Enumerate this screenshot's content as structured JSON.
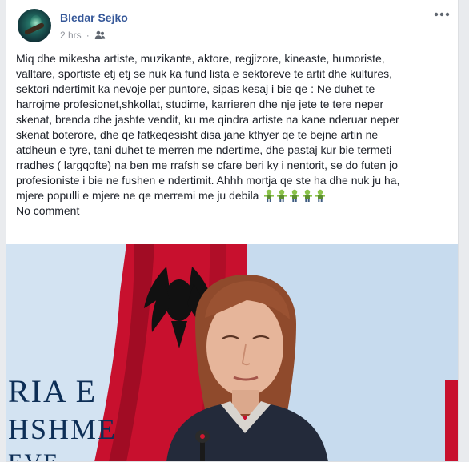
{
  "post": {
    "author": "Bledar Sejko",
    "timestamp": "2 hrs",
    "audience_icon": "friends-icon",
    "more_icon": "more-dots-icon",
    "text_lines": [
      "Miq dhe mikesha artiste, muzikante, aktore, regjizore, kineaste, humoriste,",
      "valltare, sportiste etj etj se nuk ka fund lista e sektoreve te artit dhe kultures,",
      "sektori ndertimit ka nevoje per puntore, sipas kesaj i bie qe : Ne duhet te",
      "harrojme profesionet,shkollat, studime, karrieren dhe nje jete te tere neper",
      "skenat, brenda dhe jashte vendit, ku me qindra artiste na kane nderuar neper",
      "skenat boterore, dhe qe fatkeqesisht disa jane kthyer qe te bejne artin ne",
      "atdheun e tyre, tani duhet te merren me ndertime, dhe pastaj kur bie termeti",
      "rradhes ( largqofte) na ben me rrafsh se cfare beri ky i nentorit, se do futen jo",
      "profesioniste i bie ne fushen e ndertimit. Ahhh mortja qe ste ha dhe nuk ju ha,",
      "mjere populli e mjere ne qe merremi me ju debila"
    ],
    "emoji_name": "zombie-emoji",
    "emoji_count": 5,
    "footer_line": "No comment"
  },
  "photo": {
    "wall_text_1": "RIA E",
    "wall_text_2": "HSHME",
    "wall_text_3": "EVE",
    "colors": {
      "flag_red": "#c8102e",
      "eagle": "#111111",
      "wall": "#c7dbee",
      "wall_text": "#0d2e56",
      "hair": "#8f4a2c",
      "jacket": "#232a3a"
    }
  }
}
